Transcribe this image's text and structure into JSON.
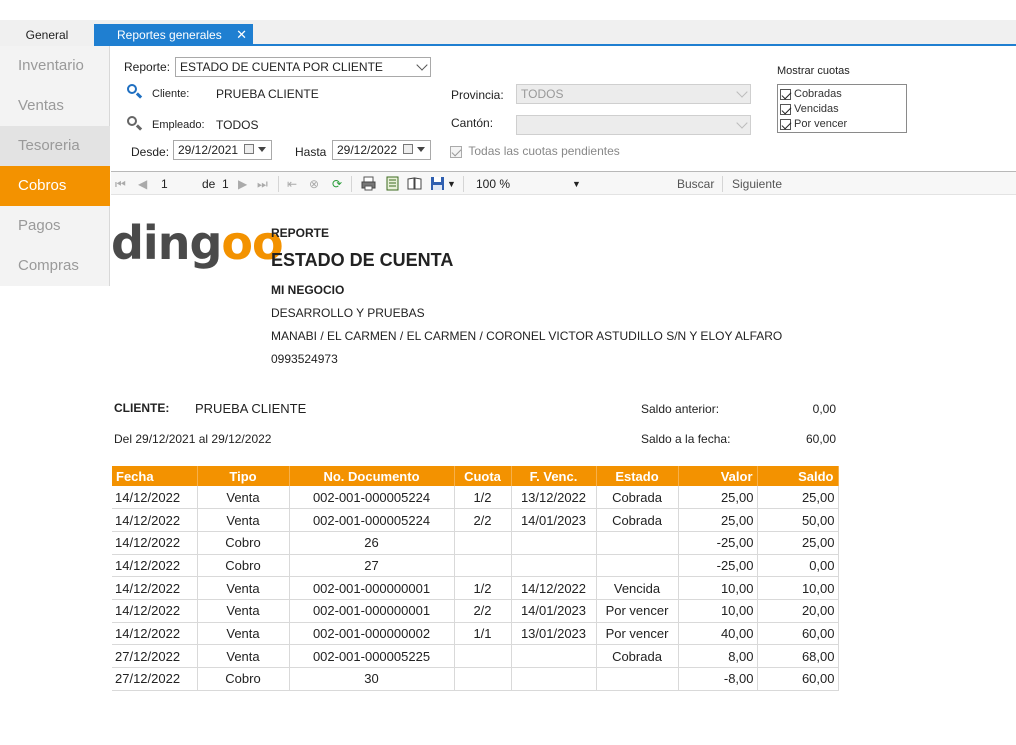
{
  "tabs": {
    "general": "General",
    "reportes": "Reportes generales",
    "close": "✕"
  },
  "sidebar": {
    "items": [
      {
        "label": "Inventario"
      },
      {
        "label": "Ventas"
      },
      {
        "label": "Tesoreria"
      },
      {
        "label": "Cobros"
      },
      {
        "label": "Pagos"
      },
      {
        "label": "Compras"
      }
    ],
    "active": "Cobros"
  },
  "filters": {
    "reporte_label": "Reporte:",
    "reporte_value": "ESTADO DE CUENTA POR CLIENTE",
    "cliente_label": "Cliente:",
    "cliente_value": "PRUEBA CLIENTE",
    "empleado_label": "Empleado:",
    "empleado_value": "TODOS",
    "desde_label": "Desde:",
    "desde_value": "29/12/2021",
    "hasta_label": "Hasta",
    "hasta_value": "29/12/2022",
    "provincia_label": "Provincia:",
    "provincia_value": "TODOS",
    "canton_label": "Cantón:",
    "canton_value": "",
    "todas_cuotas_label": "Todas las cuotas pendientes",
    "mostrar_cuotas_label": "Mostrar cuotas",
    "cuotas": [
      {
        "label": "Cobradas",
        "checked": true
      },
      {
        "label": "Vencidas",
        "checked": true
      },
      {
        "label": "Por vencer",
        "checked": true
      }
    ]
  },
  "toolbar": {
    "page": "1",
    "of_label": "de",
    "total_pages": "1",
    "zoom": "100 %",
    "buscar": "Buscar",
    "siguiente": "Siguiente"
  },
  "report": {
    "logo_text": "dingoo",
    "kicker": "REPORTE",
    "title": "ESTADO DE CUENTA",
    "business": "MI NEGOCIO",
    "line1": "DESARROLLO Y PRUEBAS",
    "address": "MANABI / EL CARMEN / EL CARMEN / CORONEL VICTOR ASTUDILLO S/N Y ELOY ALFARO",
    "phone": "0993524973",
    "cliente_label": "CLIENTE:",
    "cliente_value": "PRUEBA CLIENTE",
    "range": "Del 29/12/2021 al 29/12/2022",
    "saldo_anterior_label": "Saldo anterior:",
    "saldo_anterior_value": "0,00",
    "saldo_fecha_label": "Saldo a la fecha:",
    "saldo_fecha_value": "60,00"
  },
  "table": {
    "headers": [
      "Fecha",
      "Tipo",
      "No. Documento",
      "Cuota",
      "F. Venc.",
      "Estado",
      "Valor",
      "Saldo"
    ],
    "rows": [
      [
        "14/12/2022",
        "Venta",
        "002-001-000005224",
        "1/2",
        "13/12/2022",
        "Cobrada",
        "25,00",
        "25,00"
      ],
      [
        "14/12/2022",
        "Venta",
        "002-001-000005224",
        "2/2",
        "14/01/2023",
        "Cobrada",
        "25,00",
        "50,00"
      ],
      [
        "14/12/2022",
        "Cobro",
        "26",
        "",
        "",
        "",
        "-25,00",
        "25,00"
      ],
      [
        "14/12/2022",
        "Cobro",
        "27",
        "",
        "",
        "",
        "-25,00",
        "0,00"
      ],
      [
        "14/12/2022",
        "Venta",
        "002-001-000000001",
        "1/2",
        "14/12/2022",
        "Vencida",
        "10,00",
        "10,00"
      ],
      [
        "14/12/2022",
        "Venta",
        "002-001-000000001",
        "2/2",
        "14/01/2023",
        "Por vencer",
        "10,00",
        "20,00"
      ],
      [
        "14/12/2022",
        "Venta",
        "002-001-000000002",
        "1/1",
        "13/01/2023",
        "Por vencer",
        "40,00",
        "60,00"
      ],
      [
        "27/12/2022",
        "Venta",
        "002-001-000005225",
        "",
        "",
        "Cobrada",
        "8,00",
        "68,00"
      ],
      [
        "27/12/2022",
        "Cobro",
        "30",
        "",
        "",
        "",
        "-8,00",
        "60,00"
      ]
    ]
  },
  "colors": {
    "accent": "#f39200",
    "tab_blue": "#1f7fd1"
  }
}
